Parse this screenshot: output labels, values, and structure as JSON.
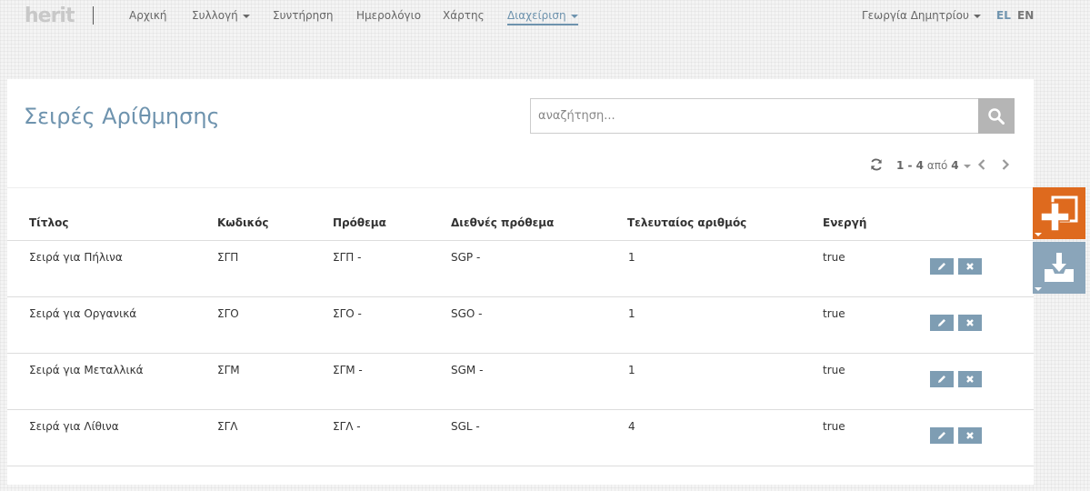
{
  "brand": {
    "logo_text": "herit"
  },
  "nav": {
    "items": [
      {
        "label": "Αρχική"
      },
      {
        "label": "Συλλογή"
      },
      {
        "label": "Συντήρηση"
      },
      {
        "label": "Ημερολόγιο"
      },
      {
        "label": "Χάρτης"
      },
      {
        "label": "Διαχείριση"
      }
    ],
    "active": "Διαχείριση",
    "user": "Γεωργία Δημητρίου",
    "languages": [
      "EL",
      "EN"
    ],
    "active_language": "EL"
  },
  "page": {
    "title": "Σειρές Αρίθμησης",
    "search": {
      "placeholder": "αναζήτηση...",
      "value": ""
    }
  },
  "pagination": {
    "range": "1 - 4",
    "of_label": "από",
    "total": "4"
  },
  "table": {
    "columns": [
      "Τίτλος",
      "Κωδικός",
      "Πρόθεμα",
      "Διεθνές πρόθεμα",
      "Τελευταίος αριθμός",
      "Ενεργή"
    ],
    "rows": [
      {
        "title": "Σειρά για Πήλινα",
        "code": "ΣΓΠ",
        "prefix": "ΣΓΠ -",
        "intl_prefix": "SGP -",
        "last_number": "1",
        "active": "true"
      },
      {
        "title": "Σειρά για Οργανικά",
        "code": "ΣΓΟ",
        "prefix": "ΣΓΟ -",
        "intl_prefix": "SGO -",
        "last_number": "1",
        "active": "true"
      },
      {
        "title": "Σειρά για Μεταλλικά",
        "code": "ΣΓΜ",
        "prefix": "ΣΓΜ -",
        "intl_prefix": "SGM -",
        "last_number": "1",
        "active": "true"
      },
      {
        "title": "Σειρά για Λίθινα",
        "code": "ΣΓΛ",
        "prefix": "ΣΓΛ -",
        "intl_prefix": "SGL -",
        "last_number": "4",
        "active": "true"
      }
    ]
  },
  "icons": {
    "search": "search-icon",
    "refresh": "refresh-icon",
    "prev": "chevron-left-icon",
    "next": "chevron-right-icon",
    "edit": "pencil-icon",
    "delete": "close-icon",
    "add": "plus-icon",
    "import": "download-tray-icon"
  },
  "colors": {
    "accent": "#6e93ae",
    "add_button": "#de6a1e",
    "import_button": "#8aa5ba",
    "row_action": "#7e9db3",
    "search_button": "#b5b5b5"
  }
}
